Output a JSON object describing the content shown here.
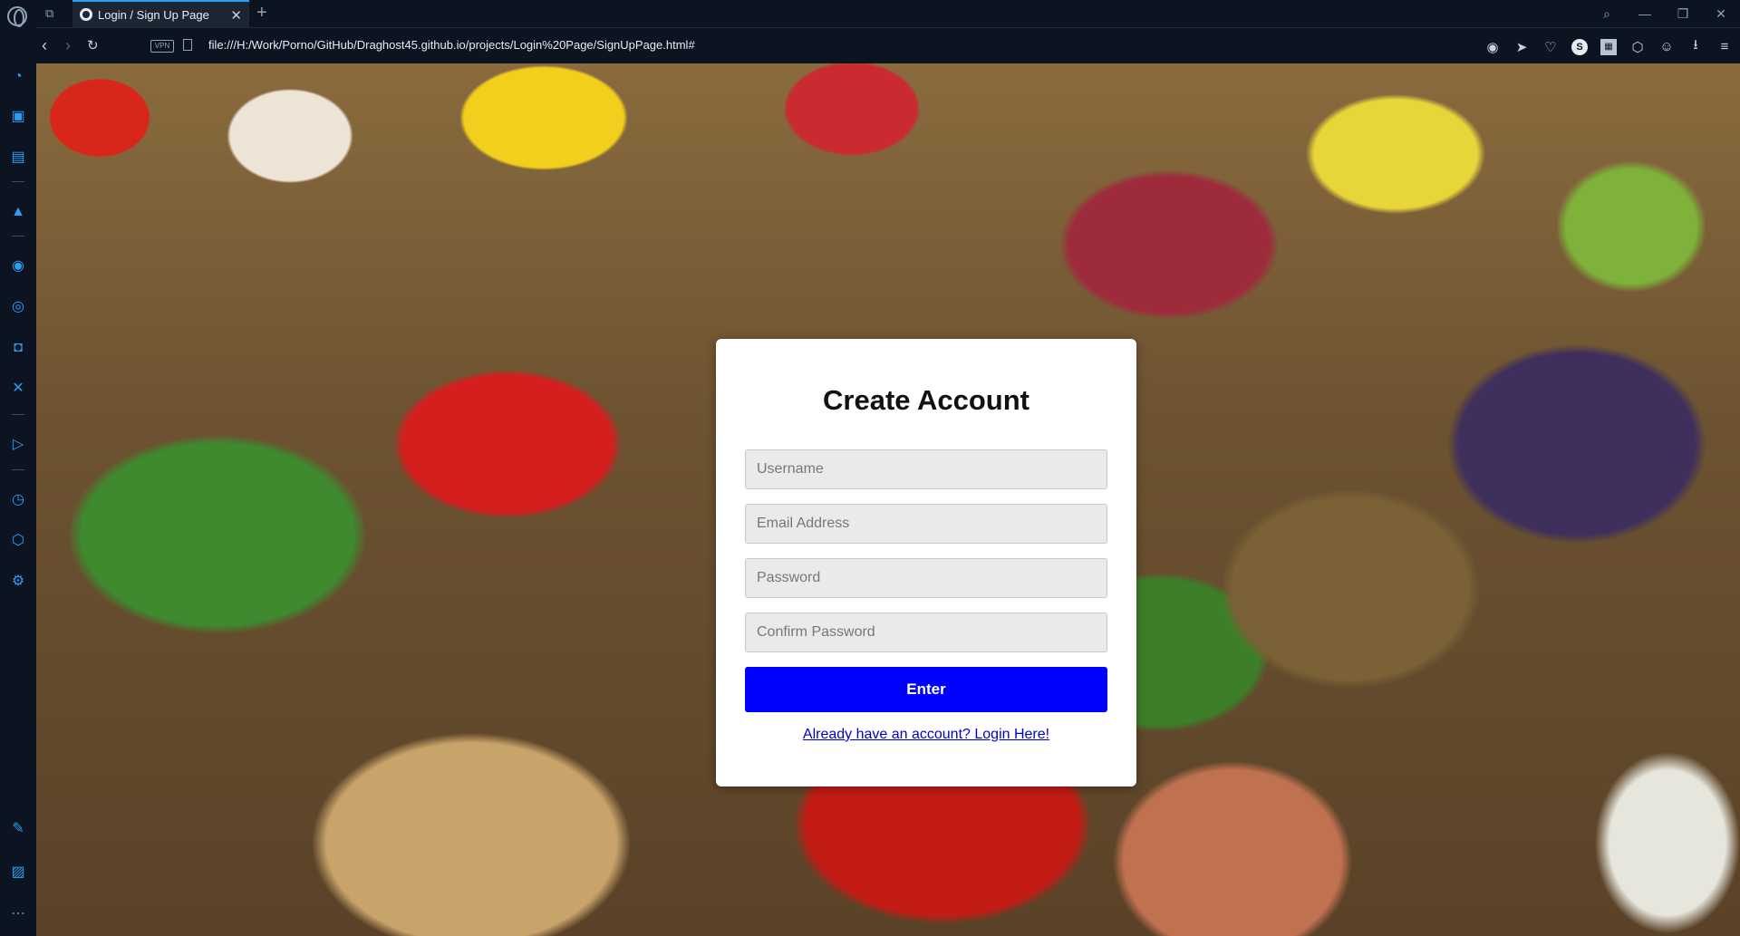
{
  "browser": {
    "tab_title": "Login / Sign Up Page",
    "url": "file:///H:/Work/Porno/GitHub/Draghost45.github.io/projects/Login%20Page/SignUpPage.html#",
    "vpn_label": "VPN",
    "accent": "#2a9df4"
  },
  "sidebar": {
    "items": [
      "speed-dial-icon",
      "workspaces-icon",
      "tab-islands-icon",
      "aria-icon",
      "messenger-icon",
      "whatsapp-icon",
      "instagram-icon",
      "x-icon",
      "player-icon",
      "history-icon",
      "extensions-icon",
      "settings-icon",
      "pinboard-icon",
      "screenshot-icon",
      "more-icon"
    ]
  },
  "form": {
    "title": "Create Account",
    "username_placeholder": "Username",
    "email_placeholder": "Email Address",
    "password_placeholder": "Password",
    "confirm_placeholder": "Confirm Password",
    "submit_label": "Enter",
    "login_link": "Already have an account? Login Here!",
    "button_color": "#0000ff"
  }
}
